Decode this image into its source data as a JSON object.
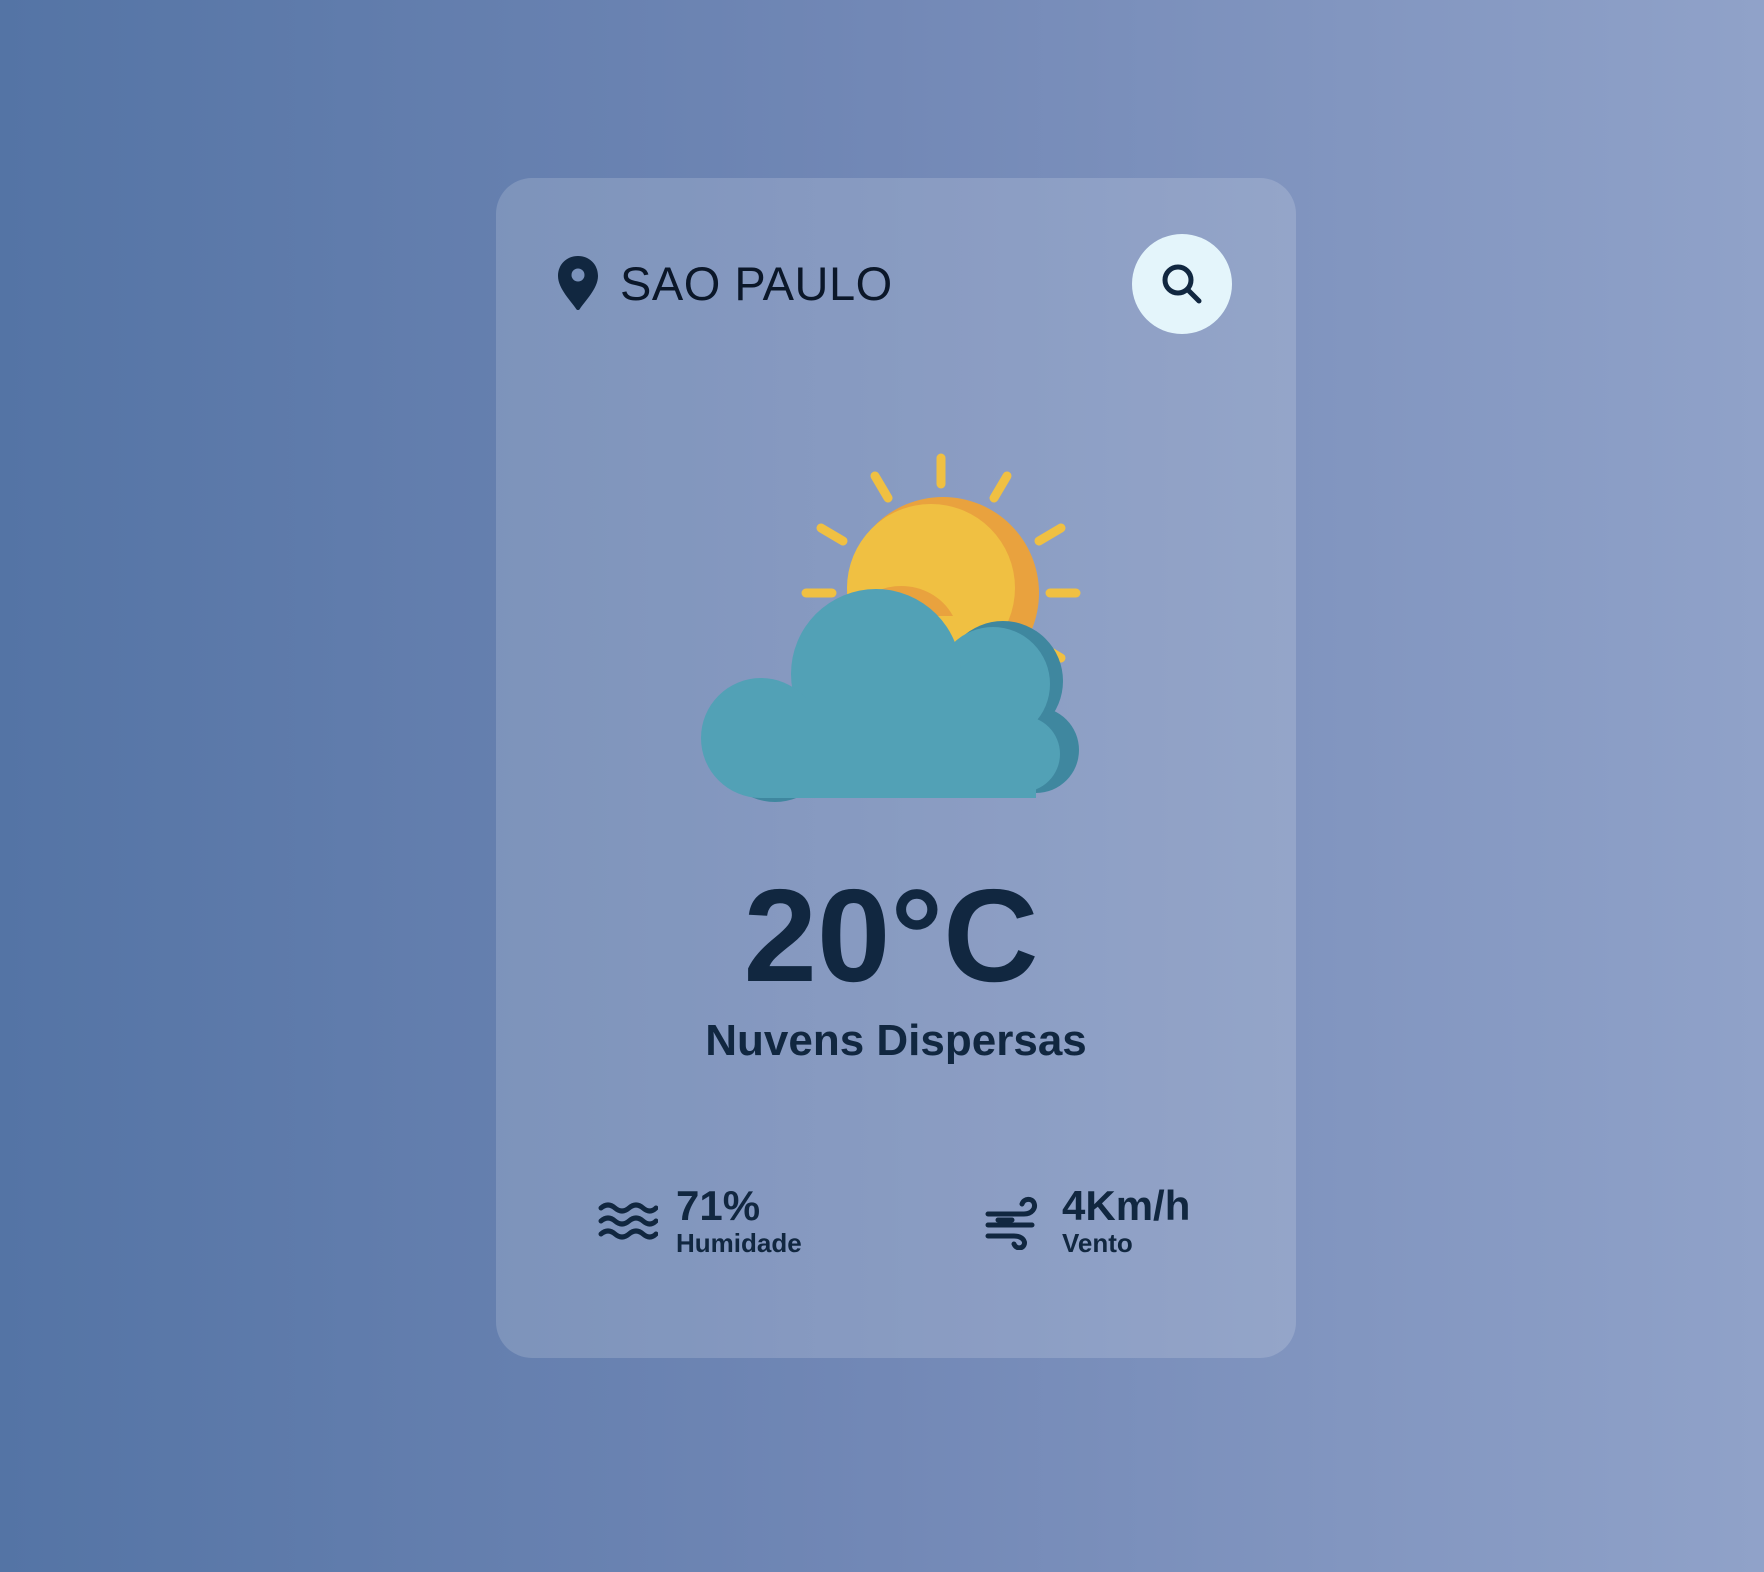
{
  "location": {
    "icon": "map-pin-icon",
    "city": "SAO PAULO"
  },
  "search": {
    "icon": "search-icon"
  },
  "current": {
    "icon": "partly-cloudy-icon",
    "temperature": "20°C",
    "description": "Nuvens Dispersas"
  },
  "details": {
    "humidity": {
      "icon": "water-waves-icon",
      "value": "71%",
      "label": "Humidade"
    },
    "wind": {
      "icon": "wind-icon",
      "value": "4Km/h",
      "label": "Vento"
    }
  },
  "colors": {
    "text": "#112740",
    "search_button_bg": "#e4f5fb",
    "sun": "#f0c042",
    "sun_shadow": "#e9a23e",
    "cloud": "#52a1b6",
    "cloud_shadow": "#3f879f"
  }
}
